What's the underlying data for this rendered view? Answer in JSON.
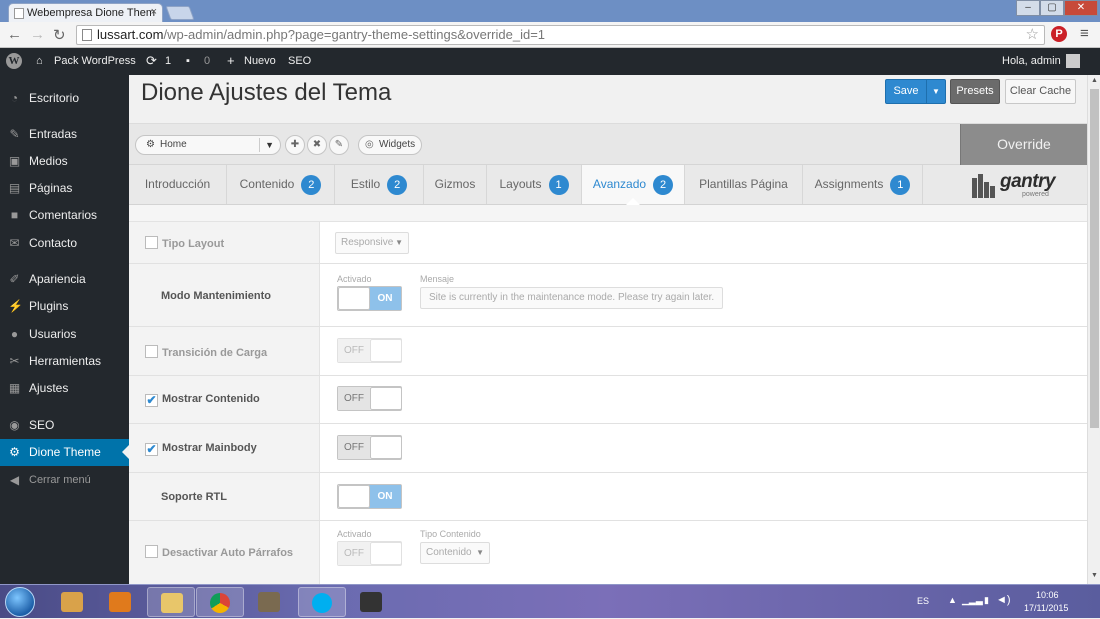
{
  "browser": {
    "tab_title": "Webempresa Dione Them",
    "tab_close": "×",
    "url_prefix": "lussart.com",
    "url_path": "/wp-admin/admin.php?page=gantry-theme-settings&override_id=1",
    "window_min": "–",
    "window_max": "▢",
    "window_close": "✕"
  },
  "adminbar": {
    "site_name": "Pack WordPress",
    "updates_count": "1",
    "comments_count": "0",
    "new_label": "Nuevo",
    "seo_label": "SEO",
    "greeting": "Hola, admin"
  },
  "sidebar": {
    "items": [
      {
        "label": "Escritorio",
        "icon": "dashboard-icon"
      },
      {
        "label": "Entradas",
        "icon": "pin-icon"
      },
      {
        "label": "Medios",
        "icon": "media-icon"
      },
      {
        "label": "Páginas",
        "icon": "pages-icon"
      },
      {
        "label": "Comentarios",
        "icon": "comment-icon"
      },
      {
        "label": "Contacto",
        "icon": "mail-icon"
      },
      {
        "label": "Apariencia",
        "icon": "brush-icon"
      },
      {
        "label": "Plugins",
        "icon": "plugin-icon"
      },
      {
        "label": "Usuarios",
        "icon": "user-icon"
      },
      {
        "label": "Herramientas",
        "icon": "wrench-icon"
      },
      {
        "label": "Ajustes",
        "icon": "settings-icon"
      },
      {
        "label": "SEO",
        "icon": "seo-icon"
      },
      {
        "label": "Dione Theme",
        "icon": "gear-icon"
      },
      {
        "label": "Cerrar menú",
        "icon": "collapse-icon"
      }
    ]
  },
  "page": {
    "title": "Dione Ajustes del Tema",
    "save_label": "Save",
    "save_dropdown": "▼",
    "presets_label": "Presets",
    "clear_cache_label": "Clear Cache"
  },
  "override_bar": {
    "assignment_select": "Home",
    "widgets_label": "Widgets",
    "override_label": "Override"
  },
  "tabs": [
    {
      "label": "Introducción",
      "badge": ""
    },
    {
      "label": "Contenido",
      "badge": "2"
    },
    {
      "label": "Estilo",
      "badge": "2"
    },
    {
      "label": "Gizmos",
      "badge": ""
    },
    {
      "label": "Layouts",
      "badge": "1"
    },
    {
      "label": "Avanzado",
      "badge": "2",
      "active": true
    },
    {
      "label": "Plantillas Página",
      "badge": ""
    },
    {
      "label": "Assignments",
      "badge": "1"
    }
  ],
  "logo": {
    "word": "gantry",
    "sub": "powered"
  },
  "settings": {
    "tipo_layout": {
      "label": "Tipo Layout",
      "value": "Responsive",
      "checked": false
    },
    "modo_mantenimiento": {
      "label": "Modo Mantenimiento",
      "activado_label": "Activado",
      "toggle": "ON",
      "mensaje_label": "Mensaje",
      "mensaje_value": "Site is currently in the maintenance mode. Please try again later."
    },
    "transicion_carga": {
      "label": "Transición de Carga",
      "toggle": "OFF",
      "checked": false
    },
    "mostrar_contenido": {
      "label": "Mostrar Contenido",
      "toggle": "OFF",
      "checked": true
    },
    "mostrar_mainbody": {
      "label": "Mostrar Mainbody",
      "toggle": "OFF",
      "checked": true
    },
    "soporte_rtl": {
      "label": "Soporte RTL",
      "toggle": "ON"
    },
    "desactivar_auto_parrafos": {
      "label": "Desactivar Auto Párrafos",
      "activado_label": "Activado",
      "toggle": "OFF",
      "tipo_label": "Tipo Contenido",
      "tipo_value": "Contenido",
      "checked": false
    }
  },
  "taskbar": {
    "lang": "ES",
    "time": "10:06",
    "date": "17/11/2015"
  },
  "colors": {
    "accent": "#2e89d0",
    "adminbar": "#23282d",
    "active_menu": "#0073aa"
  }
}
